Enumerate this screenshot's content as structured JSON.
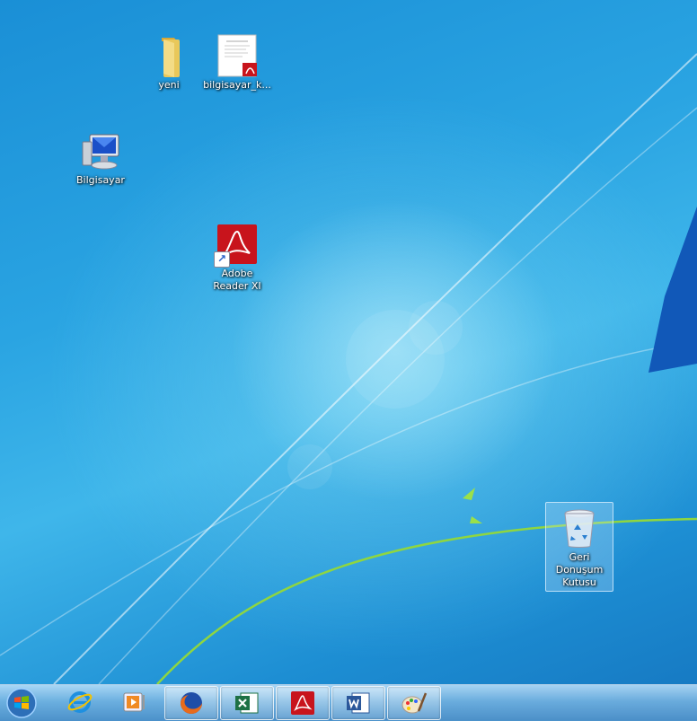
{
  "desktop": {
    "icons": [
      {
        "label": "yeni",
        "icon": "folder-icon"
      },
      {
        "label": "bilgisayar_k...",
        "icon": "pdf-document-icon"
      },
      {
        "label": "Bilgisayar",
        "icon": "computer-icon"
      },
      {
        "label": "Adobe\nReader XI",
        "icon": "adobe-reader-icon"
      },
      {
        "label": "Geri\nDonuşum\nKutusu",
        "icon": "recycle-bin-icon"
      }
    ]
  },
  "taskbar": {
    "start": {
      "icon": "windows-start-icon"
    },
    "pinned": [
      {
        "name": "Internet Explorer",
        "icon": "internet-explorer-icon"
      },
      {
        "name": "Media Player",
        "icon": "media-player-icon"
      },
      {
        "name": "Firefox",
        "icon": "firefox-icon"
      },
      {
        "name": "Excel",
        "icon": "excel-icon"
      },
      {
        "name": "Adobe Reader",
        "icon": "adobe-reader-icon"
      },
      {
        "name": "Word",
        "icon": "word-icon"
      },
      {
        "name": "Paint",
        "icon": "paint-icon"
      }
    ]
  },
  "colors": {
    "wallpaper_blue": "#1a8fd6",
    "adobe_red": "#c8141c",
    "excel_green": "#1e7145",
    "word_blue": "#2b579a"
  }
}
